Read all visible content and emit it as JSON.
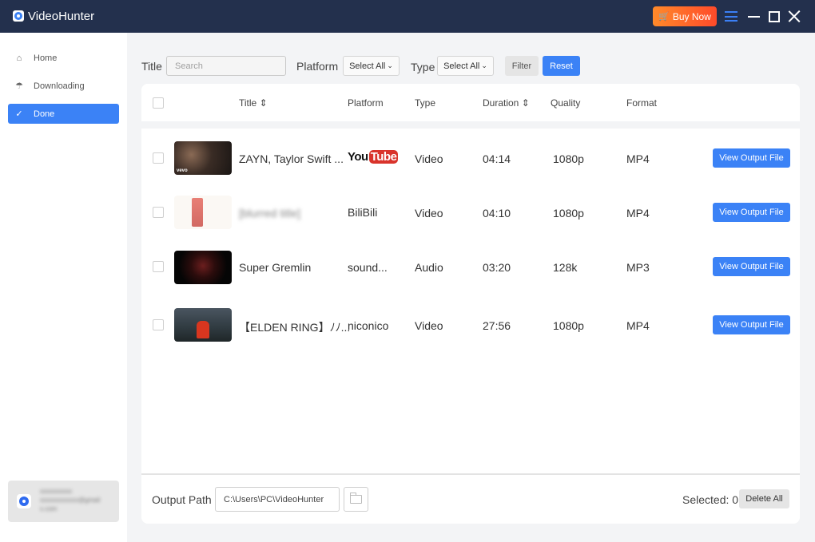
{
  "app": {
    "title": "VideoHunter",
    "buy_now_label": "Buy Now"
  },
  "sidebar": {
    "items": [
      {
        "label": "Home",
        "icon": "home-icon",
        "active": false
      },
      {
        "label": "Downloading",
        "icon": "download-cloud-icon",
        "active": false
      },
      {
        "label": "Done",
        "icon": "check-circle-icon",
        "active": true
      }
    ],
    "user": {
      "line1": "xxxxxxxxxx",
      "line2": "xxxxxxxxxxxx@gmail",
      "line3": "x.com"
    }
  },
  "filters": {
    "title_label": "Title",
    "search_placeholder": "Search",
    "platform_label": "Platform",
    "platform_value": "Select All",
    "type_label": "Type",
    "type_value": "Select All",
    "filter_label": "Filter",
    "reset_label": "Reset"
  },
  "table": {
    "columns": {
      "title": "Title",
      "platform": "Platform",
      "type": "Type",
      "duration": "Duration",
      "quality": "Quality",
      "format": "Format"
    },
    "rows": [
      {
        "title": "ZAYN, Taylor Swift ...",
        "platform": "YouTube",
        "platform_logo": {
          "you": "You",
          "tube": "Tube"
        },
        "type": "Video",
        "duration": "04:14",
        "quality": "1080p",
        "format": "MP4",
        "action": "View Output File",
        "thumb": "dark music video still"
      },
      {
        "title": "[blurred title]",
        "platform": "BiliBili",
        "type": "Video",
        "duration": "04:10",
        "quality": "1080p",
        "format": "MP4",
        "action": "View Output File",
        "thumb": "red kanji poster"
      },
      {
        "title": "Super Gremlin",
        "platform": "sound...",
        "type": "Audio",
        "duration": "03:20",
        "quality": "128k",
        "format": "MP3",
        "action": "View Output File",
        "thumb": "dark album art"
      },
      {
        "title": "【ELDEN RING】ﾉﾉ...",
        "platform": "niconico",
        "type": "Video",
        "duration": "27:56",
        "quality": "1080p",
        "format": "MP4",
        "action": "View Output File",
        "thumb": "game scene"
      }
    ]
  },
  "footer": {
    "output_path_label": "Output Path",
    "output_path_value": "C:\\Users\\PC\\VideoHunter",
    "selected_text": "Selected: 0",
    "delete_all_label": "Delete All"
  },
  "colors": {
    "accent": "#3b82f6",
    "titlebar": "#23304d",
    "buy_now_start": "#ff8a2a",
    "buy_now_end": "#ff4a2a",
    "youtube_red": "#d9332b"
  }
}
